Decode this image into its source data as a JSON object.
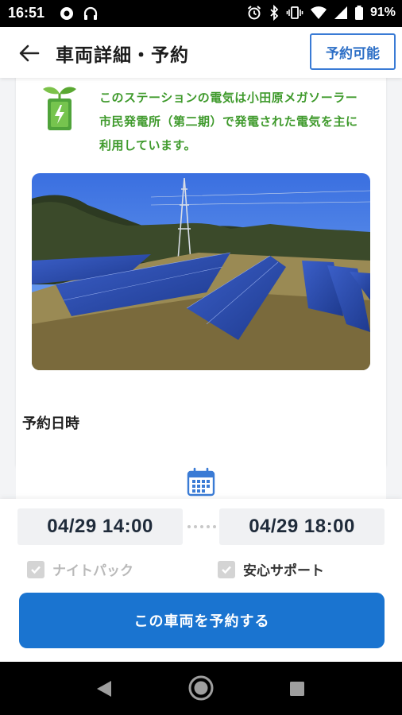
{
  "status_bar": {
    "time": "16:51",
    "battery": "91%",
    "left_icons": [
      "record-icon",
      "headphones-icon"
    ],
    "right_icons": [
      "alarm-icon",
      "bluetooth-icon",
      "vibrate-icon",
      "wifi-icon",
      "signal-icon",
      "battery-icon"
    ]
  },
  "app_bar": {
    "title": "車両詳細・予約",
    "availability_label": "予約可能"
  },
  "station_info": {
    "text": "このステーションの電気は小田原メガソーラー市民発電所（第二期）で発電された電気を主に利用しています。"
  },
  "reservation": {
    "section_label": "予約日時",
    "start": "04/29 14:00",
    "end": "04/29 18:00",
    "options": [
      {
        "label": "ナイトパック",
        "checked": true,
        "enabled": false
      },
      {
        "label": "安心サポート",
        "checked": true,
        "enabled": true
      }
    ],
    "reserve_button": "この車両を予約する"
  },
  "colors": {
    "accent": "#1a74d0",
    "eco_green": "#3f9a2c",
    "available_border": "#3a7bd5"
  }
}
